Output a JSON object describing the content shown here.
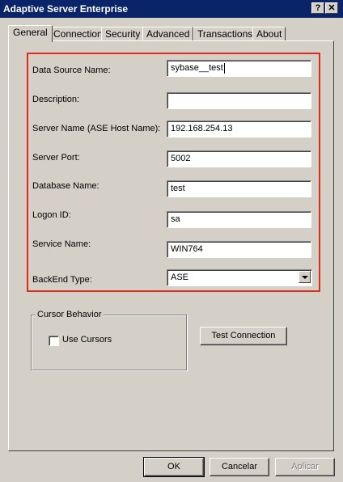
{
  "window": {
    "title": "Adaptive Server Enterprise",
    "help_label": "?",
    "close_label": "✕"
  },
  "tabs": [
    {
      "label": "General",
      "active": true
    },
    {
      "label": "Connection"
    },
    {
      "label": "Security"
    },
    {
      "label": "Advanced"
    },
    {
      "label": "Transactions"
    },
    {
      "label": "About"
    }
  ],
  "fields": {
    "data_source_name": {
      "label": "Data Source Name:",
      "value": "sybase__test"
    },
    "description": {
      "label": "Description:",
      "value": ""
    },
    "server_name": {
      "label": "Server Name (ASE Host Name):",
      "value": "192.168.254.13"
    },
    "server_port": {
      "label": "Server Port:",
      "value": "5002"
    },
    "database_name": {
      "label": "Database Name:",
      "value": "test"
    },
    "logon_id": {
      "label": "Logon ID:",
      "value": "sa"
    },
    "service_name": {
      "label": "Service Name:",
      "value": "WIN764"
    },
    "backend_type": {
      "label": "BackEnd Type:",
      "value": "ASE"
    }
  },
  "cursor_behavior": {
    "title": "Cursor Behavior",
    "use_cursors_label": "Use Cursors",
    "use_cursors_checked": false
  },
  "buttons": {
    "test_connection": "Test Connection",
    "ok": "OK",
    "cancel": "Cancelar",
    "apply": "Aplicar"
  },
  "colors": {
    "titlebar": "#0a246a",
    "highlight_box": "#e02a1a",
    "face": "#d4d0c8"
  }
}
